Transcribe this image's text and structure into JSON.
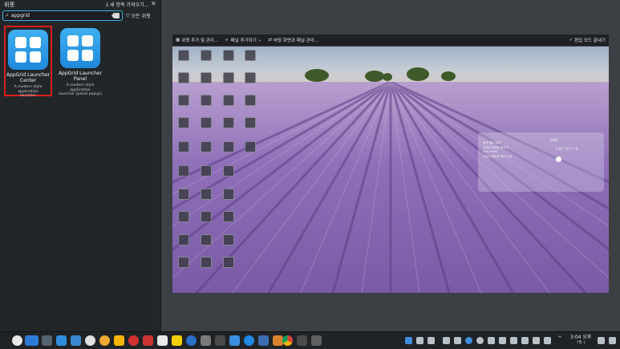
{
  "panel": {
    "title": "위젯",
    "get_new_label": "새 항목 가져오기...",
    "search_value": "appgrid",
    "filter_label": "모든 위젯"
  },
  "widgets": [
    {
      "name_line1": "AppGrid Launcher",
      "name_line2": "Center",
      "desc_line1": "A modern style application",
      "desc_line2": "launcher"
    },
    {
      "name_line1": "AppGrid Launcher",
      "name_line2": "Panel",
      "desc_line1": "A modern style application",
      "desc_line2": "launcher (panel popup)"
    }
  ],
  "preview_toolbar": {
    "add_widgets": "위젯 추가 및 관리...",
    "add_panel": "패널 추가하기",
    "configure": "바탕 화면과 패널 관리...",
    "exit": "편집 모드 끝내기"
  },
  "calendar": {
    "month": "JULY",
    "days": "S M T W T F S",
    "events": [
      "현재 월요 일정",
      "오늘은 예정된 행사가",
      "This week",
      "오늘은 예정된 행사가 없"
    ]
  },
  "clock": {
    "time": "3:04 오후",
    "date": "7월 1"
  },
  "colors": {
    "accent": "#3daee9",
    "selection": "#d81e1e",
    "app_icon": "#2196f3"
  }
}
